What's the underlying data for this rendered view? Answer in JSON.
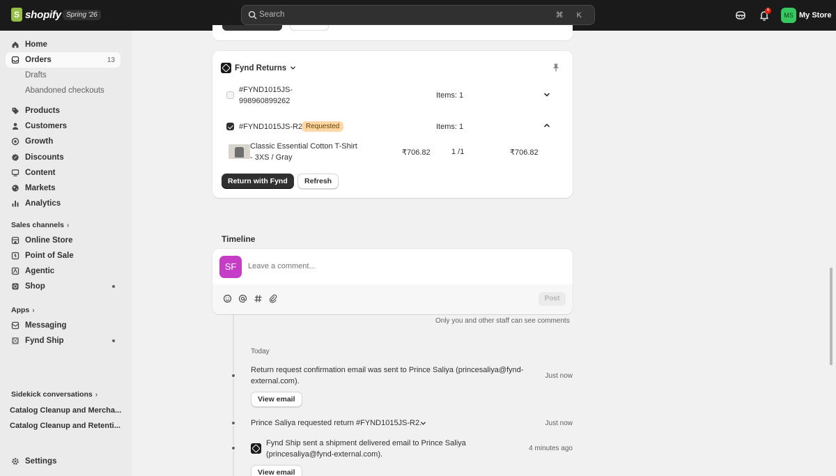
{
  "topbar": {
    "logo_text": "shopify",
    "season": "Spring '26",
    "search_placeholder": "Search",
    "shortcut": "⌘ K",
    "notification_count": "6",
    "store_initials": "MS",
    "store_name": "My Store"
  },
  "sidebar": {
    "items": [
      {
        "label": "Home"
      },
      {
        "label": "Orders",
        "count": "13"
      },
      {
        "label": "Drafts"
      },
      {
        "label": "Abandoned checkouts"
      },
      {
        "label": "Products"
      },
      {
        "label": "Customers"
      },
      {
        "label": "Growth"
      },
      {
        "label": "Discounts"
      },
      {
        "label": "Content"
      },
      {
        "label": "Markets"
      },
      {
        "label": "Analytics"
      }
    ],
    "sales_channels_heading": "Sales channels",
    "sales_channels": [
      {
        "label": "Online Store"
      },
      {
        "label": "Point of Sale"
      },
      {
        "label": "Agentic"
      },
      {
        "label": "Shop"
      }
    ],
    "apps_heading": "Apps",
    "apps": [
      {
        "label": "Messaging"
      },
      {
        "label": "Fynd Ship"
      }
    ],
    "sidekick_heading": "Sidekick conversations",
    "conversations": [
      {
        "label": "Catalog Cleanup and Mercha..."
      },
      {
        "label": "Catalog Cleanup and Retenti..."
      }
    ],
    "settings_label": "Settings"
  },
  "fynd_returns": {
    "title": "Fynd Returns",
    "returns": [
      {
        "id_line1": "#FYND1015JS-",
        "id_line2": "998960899262",
        "items": "Items: 1",
        "checked": false
      },
      {
        "id": "#FYND1015JS-R2",
        "badge": "Requested",
        "items": "Items: 1",
        "checked": true
      }
    ],
    "line_item": {
      "name_line1": "Classic Essential Cotton T-Shirt",
      "name_line2": "- 3XS / Gray",
      "price": "₹706.82",
      "qty": "1 /1",
      "total": "₹706.82"
    },
    "return_button": "Return with Fynd",
    "refresh_button": "Refresh"
  },
  "timeline": {
    "title": "Timeline",
    "avatar_initials": "SF",
    "comment_placeholder": "Leave a comment...",
    "post_button": "Post",
    "visibility_note": "Only you and other staff can see comments",
    "date_label": "Today",
    "events": [
      {
        "line1": "Return request confirmation email was sent to Prince Saliya (princesaliya@fynd-",
        "line2": "external.com).",
        "time": "Just now",
        "button": "View email"
      },
      {
        "line1": "Prince Saliya requested return #FYND1015JS-R2.",
        "time": "Just now"
      },
      {
        "line1": "Fynd Ship sent a shipment delivered email to Prince Saliya",
        "line2": "(princesaliya@fynd-external.com).",
        "time": "4 minutes ago",
        "button": "View email"
      }
    ]
  },
  "colors": {
    "topbar": "#1a1a1a",
    "sidebar": "#ebebeb",
    "background": "#f1f1f1",
    "badge_requested": "#ffd6a4",
    "avatar_sf": "#c53cc6",
    "store_avatar": "#36c85f"
  }
}
